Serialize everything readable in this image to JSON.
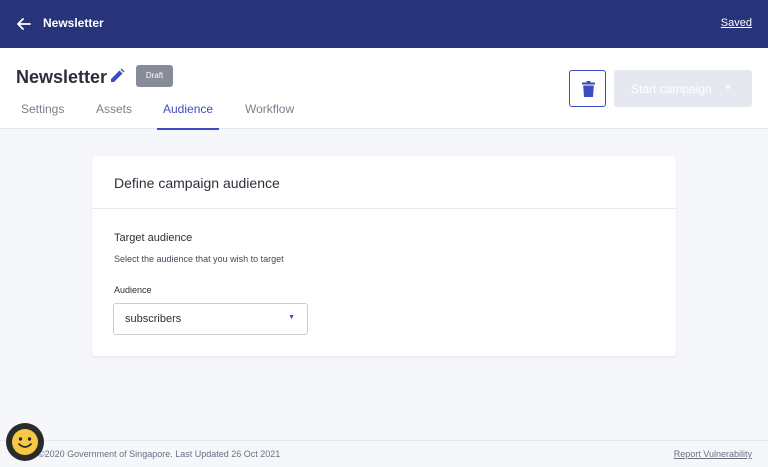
{
  "topbar": {
    "title": "Newsletter",
    "saved_label": "Saved",
    "back_icon": "arrow-left-icon"
  },
  "header": {
    "campaign_name": "Newsletter",
    "status_badge": "Draft",
    "edit_icon": "pencil-icon",
    "tabs": [
      {
        "label": "Settings",
        "active": false
      },
      {
        "label": "Assets",
        "active": false
      },
      {
        "label": "Audience",
        "active": true
      },
      {
        "label": "Workflow",
        "active": false
      }
    ],
    "delete_icon": "trash-icon",
    "start_campaign_label": "Start campaign",
    "start_campaign_disabled": true
  },
  "card": {
    "title": "Define campaign audience",
    "section_title": "Target audience",
    "section_description": "Select the audience that you wish to target",
    "audience_label": "Audience",
    "audience_value": "subscribers"
  },
  "footer": {
    "copyright": "©2020 Government of Singapore. Last Updated 26 Oct 2021",
    "report_link": "Report Vulnerability"
  },
  "colors": {
    "topbar_bg": "#283479",
    "accent": "#3c4dc2",
    "badge_bg": "#878c98",
    "disabled_btn_bg": "#e6e8ef"
  }
}
